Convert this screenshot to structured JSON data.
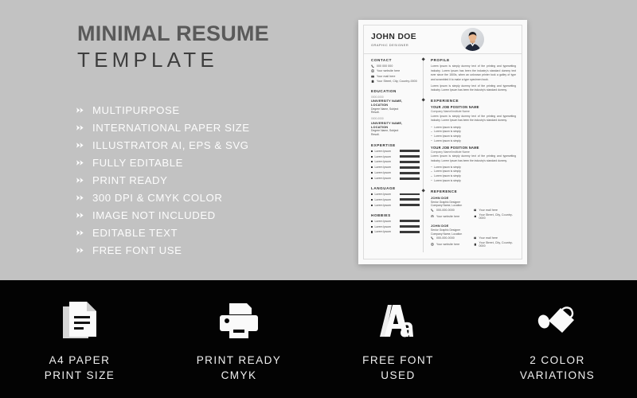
{
  "background_color": "#c2c2c2",
  "promo": {
    "title_line1": "MINIMAL RESUME",
    "title_line2": "TEMPLATE",
    "features": [
      "MULTIPURPOSE",
      "INTERNATIONAL PAPER SIZE",
      "ILLUSTRATOR AI, EPS & SVG",
      "FULLY EDITABLE",
      "PRINT READY",
      "300 DPI & CMYK COLOR",
      "IMAGE NOT INCLUDED",
      "EDITABLE TEXT",
      "FREE FONT USE"
    ],
    "bullet_icon": "chevron-right-icon"
  },
  "resume": {
    "name": "JOHN DOE",
    "role": "GRAPHIC DESIGNER",
    "avatar_icon": "profile-photo",
    "contact": {
      "heading": "CONTACT",
      "items": [
        {
          "icon": "phone-icon",
          "text": "000 000 000"
        },
        {
          "icon": "globe-icon",
          "text": "Your website here"
        },
        {
          "icon": "mail-icon",
          "text": "Your mail here"
        },
        {
          "icon": "home-icon",
          "text": "Your Street, City, Country-0000"
        }
      ]
    },
    "education": {
      "heading": "EDUCATION",
      "entries": [
        {
          "date": "0000-0000",
          "university": "UNIVERSITY NAME, LOCATION",
          "degree": "Degree Name, Subject",
          "result": "Result."
        },
        {
          "date": "0000-0000",
          "university": "UNIVERSITY NAME, LOCATION",
          "degree": "Degree Name, Subject",
          "result": "Result."
        }
      ]
    },
    "expertise": {
      "heading": "EXPERTISE",
      "items": [
        {
          "label": "Lorem Ipsum",
          "level": 100
        },
        {
          "label": "Lorem Ipsum",
          "level": 100
        },
        {
          "label": "Lorem Ipsum",
          "level": 100
        },
        {
          "label": "Lorem Ipsum",
          "level": 100
        },
        {
          "label": "Lorem Ipsum",
          "level": 100
        },
        {
          "label": "Lorem Ipsum",
          "level": 100
        }
      ]
    },
    "language": {
      "heading": "LANGUAGE",
      "items": [
        {
          "label": "Lorem Ipsum",
          "level": 100
        },
        {
          "label": "Lorem Ipsum",
          "level": 100
        },
        {
          "label": "Lorem Ipsum",
          "level": 100
        }
      ]
    },
    "hobbies": {
      "heading": "HOBBIES",
      "items": [
        {
          "label": "Lorem Ipsum",
          "level": 100
        },
        {
          "label": "Lorem Ipsum",
          "level": 100
        },
        {
          "label": "Lorem Ipsum",
          "level": 100
        }
      ]
    },
    "profile": {
      "heading": "PROFILE",
      "paragraph1": "Lorem Ipsum is simply dummy text of the printing and typesetting industry. Lorem Ipsum has been the industry's standard dummy text ever since the 1500s, when an unknown printer took a galley of type and scrambled it to make a type specimen book.",
      "paragraph2": "Lorem Ipsum is simply dummy text of the printing and typesetting industry. Lorem Ipsum has been the industry's standard dummy."
    },
    "experience": {
      "heading": "EXPERIENCE",
      "entries": [
        {
          "title": "YOUR JOB POSITION NAME",
          "company": "Company Name/Institute Name",
          "description": "Lorem Ipsum is simply dummy text of the printing and typesetting industry. Lorem Ipsum has been the industry's standard dummy.",
          "bullets": [
            "Lorem Ipsum is simply",
            "Lorem Ipsum is simply",
            "Lorem Ipsum is simply",
            "Lorem Ipsum is simply"
          ]
        },
        {
          "title": "YOUR JOB POSITION NAME",
          "company": "Company Name/Institute Name",
          "description": "Lorem Ipsum is simply dummy text of the printing and typesetting industry. Lorem Ipsum has been the industry's standard dummy.",
          "bullets": [
            "Lorem Ipsum is simply",
            "Lorem Ipsum is simply",
            "Lorem Ipsum is simply",
            "Lorem Ipsum is simply"
          ]
        }
      ]
    },
    "reference": {
      "heading": "REFERENCE",
      "entries": [
        {
          "name": "JOHN DOE",
          "role": "Senior Graphic Designer",
          "company": "Company Name, Location",
          "contacts": [
            {
              "icon": "phone-icon",
              "text": "000-000-0000"
            },
            {
              "icon": "mail-icon",
              "text": "Your mail here"
            },
            {
              "icon": "globe-icon",
              "text": "Your website here"
            },
            {
              "icon": "home-icon",
              "text": "Your Street, City, Country-0000"
            }
          ]
        },
        {
          "name": "JOHN DOE",
          "role": "Senior Graphic Designer",
          "company": "Company Name, Location",
          "contacts": [
            {
              "icon": "phone-icon",
              "text": "000-000-0000"
            },
            {
              "icon": "mail-icon",
              "text": "Your mail here"
            },
            {
              "icon": "globe-icon",
              "text": "Your website here"
            },
            {
              "icon": "home-icon",
              "text": "Your Street, City, Country-0000"
            }
          ]
        }
      ]
    }
  },
  "footer": {
    "background_color": "#030303",
    "tiles": [
      {
        "icon": "document-icon",
        "line1": "A4 PAPER",
        "line2": "PRINT SIZE"
      },
      {
        "icon": "printer-icon",
        "line1": "PRINT READY",
        "line2": "CMYK"
      },
      {
        "icon": "typography-aa-icon",
        "line1": "FREE FONT",
        "line2": "USED"
      },
      {
        "icon": "color-swatch-tag-icon",
        "line1": "2 COLOR",
        "line2": "VARIATIONS"
      }
    ]
  }
}
